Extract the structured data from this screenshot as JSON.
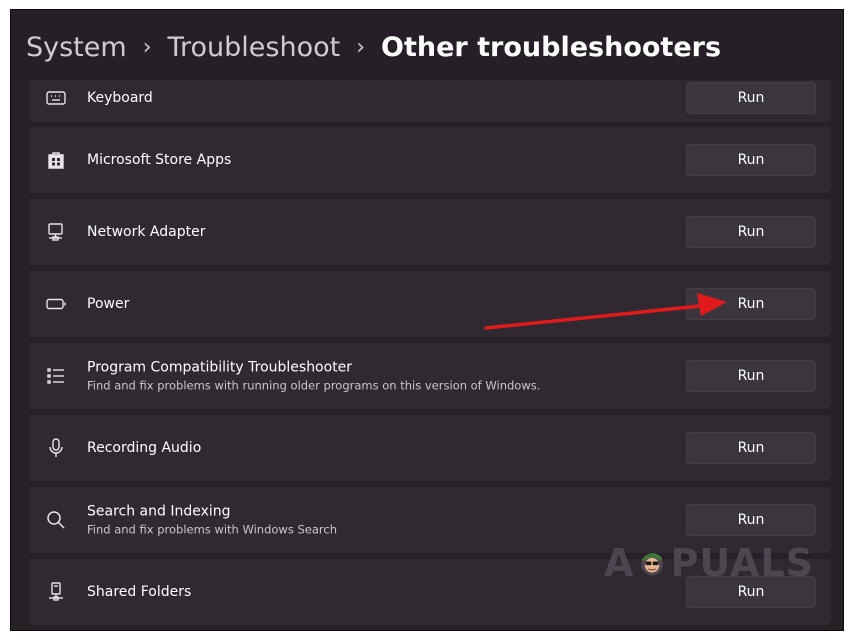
{
  "breadcrumb": {
    "items": [
      "System",
      "Troubleshoot",
      "Other troubleshooters"
    ],
    "separator": "›"
  },
  "troubleshooters": [
    {
      "title": "Keyboard",
      "description": "",
      "icon": "keyboard-icon",
      "button": "Run"
    },
    {
      "title": "Microsoft Store Apps",
      "description": "",
      "icon": "store-icon",
      "button": "Run"
    },
    {
      "title": "Network Adapter",
      "description": "",
      "icon": "network-adapter-icon",
      "button": "Run"
    },
    {
      "title": "Power",
      "description": "",
      "icon": "battery-icon",
      "button": "Run"
    },
    {
      "title": "Program Compatibility Troubleshooter",
      "description": "Find and fix problems with running older programs on this version of Windows.",
      "icon": "list-icon",
      "button": "Run"
    },
    {
      "title": "Recording Audio",
      "description": "",
      "icon": "microphone-icon",
      "button": "Run"
    },
    {
      "title": "Search and Indexing",
      "description": "Find and fix problems with Windows Search",
      "icon": "search-icon",
      "button": "Run"
    },
    {
      "title": "Shared Folders",
      "description": "",
      "icon": "shared-folder-icon",
      "button": "Run"
    }
  ],
  "watermark": {
    "left": "A",
    "right": "PUALS"
  },
  "colors": {
    "background": "#272027",
    "row": "#302932",
    "button": "#3b353d",
    "annotation_arrow": "#e11b1b"
  }
}
